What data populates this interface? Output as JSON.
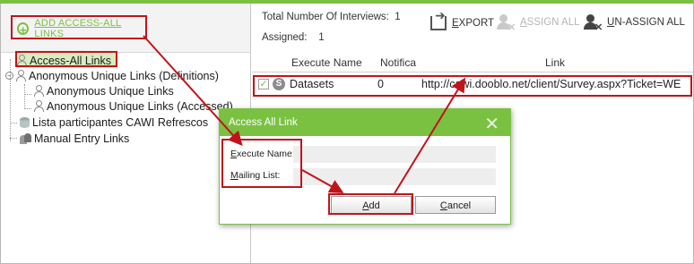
{
  "left_toolbar": {
    "add_access_label": "ADD ACCESS-ALL LINKS"
  },
  "tree": [
    {
      "label": "Access-All Links"
    },
    {
      "label": "Anonymous Unique Links (Definitions)"
    },
    {
      "label": "Anonymous Unique Links"
    },
    {
      "label": "Anonymous Unique Links (Accessed)"
    },
    {
      "label": "Lista participantes CAWI Refrescos"
    },
    {
      "label": "Manual Entry Links"
    }
  ],
  "stats": {
    "total_label": "Total Number Of Interviews:",
    "total_value": "1",
    "assigned_label": "Assigned:",
    "assigned_value": "1"
  },
  "toolbar": {
    "export_label": "EXPORT",
    "assign_all_label": "ASSIGN ALL",
    "unassign_all_label": "UN-ASSIGN ALL"
  },
  "grid": {
    "columns": [
      "Execute Name",
      "Notifica",
      "Link"
    ],
    "rows": [
      {
        "checked": "✓",
        "icon_letter": "S",
        "execute_name": "Datasets",
        "notifica": "0",
        "link": "http://cawi.dooblo.net/client/Survey.aspx?Ticket=WE"
      }
    ]
  },
  "dialog": {
    "title": "Access All Link",
    "close": "✕",
    "execute_name_label": "Execute Name:",
    "execute_name_value": "",
    "mailing_list_label": "Mailing List:",
    "mailing_list_value": "",
    "add_label": "Add",
    "cancel_label": "Cancel"
  },
  "colors": {
    "accent": "#7ac142",
    "highlight": "#c0141a"
  }
}
